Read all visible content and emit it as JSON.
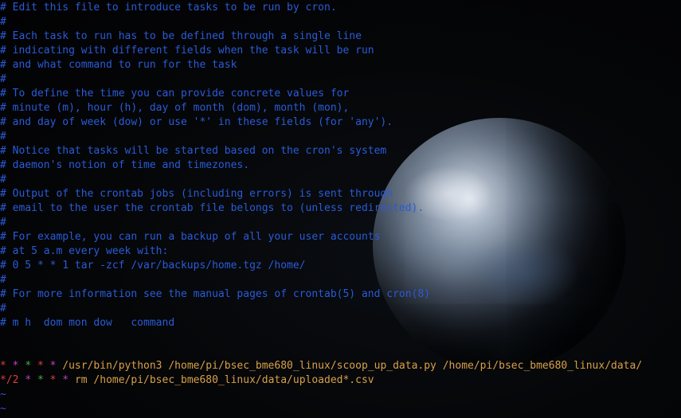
{
  "comments": [
    "# Edit this file to introduce tasks to be run by cron.",
    "#",
    "# Each task to run has to be defined through a single line",
    "# indicating with different fields when the task will be run",
    "# and what command to run for the task",
    "#",
    "# To define the time you can provide concrete values for",
    "# minute (m), hour (h), day of month (dom), month (mon),",
    "# and day of week (dow) or use '*' in these fields (for 'any').",
    "#",
    "# Notice that tasks will be started based on the cron's system",
    "# daemon's notion of time and timezones.",
    "#",
    "# Output of the crontab jobs (including errors) is sent through",
    "# email to the user the crontab file belongs to (unless redirected).",
    "#",
    "# For example, you can run a backup of all your user accounts",
    "# at 5 a.m every week with:",
    "# 0 5 * * 1 tar -zcf /var/backups/home.tgz /home/",
    "#",
    "# For more information see the manual pages of crontab(5) and cron(8)",
    "#",
    "# m h  dom mon dow   command"
  ],
  "jobs": [
    {
      "f1": "*",
      "f2": "*",
      "f3": "*",
      "f4": "*",
      "f5": "*",
      "command": "/usr/bin/python3 /home/pi/bsec_bme680_linux/scoop_up_data.py /home/pi/bsec_bme680_linux/data/"
    },
    {
      "f1": "*/2",
      "f2": "*",
      "f3": "*",
      "f4": "*",
      "f5": "*",
      "command": "rm /home/pi/bsec_bme680_linux/data/uploaded*.csv"
    }
  ],
  "tilde_lines": [
    "~",
    "~"
  ],
  "colors": {
    "comment": "#2a5bd7",
    "field_red": "#d84040",
    "field_magenta": "#c040c0",
    "field_green": "#40b040",
    "command": "#d8a048",
    "tilde": "#3b4fd0"
  }
}
